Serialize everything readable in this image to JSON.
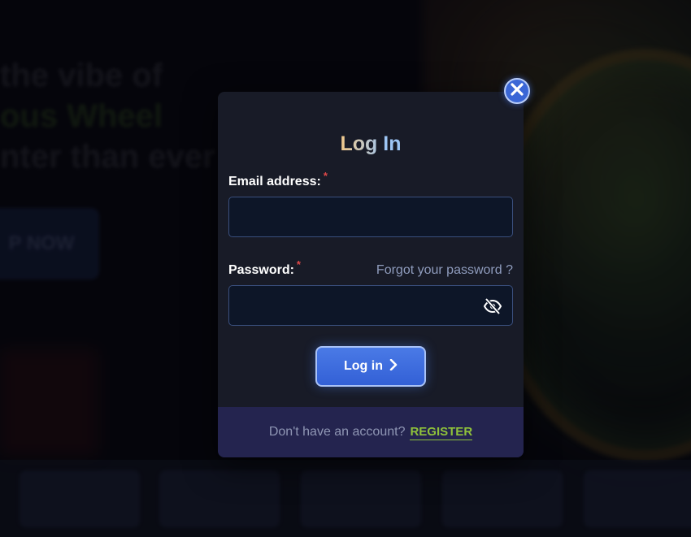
{
  "background": {
    "headline_line1": "the vibe of",
    "headline_line2": "ous Wheel",
    "headline_line3": "nter than ever",
    "cta_label": "P NOW"
  },
  "modal": {
    "title": "Log In",
    "email": {
      "label": "Email address:",
      "required_mark": "*",
      "value": "",
      "placeholder": ""
    },
    "password": {
      "label": "Password:",
      "required_mark": "*",
      "value": "",
      "placeholder": "",
      "toggle_icon": "eye-off-icon"
    },
    "forgot_password": "Forgot your password ?",
    "login_button": "Log in",
    "login_icon": "chevron-right-icon",
    "close_icon": "close-icon",
    "footer": {
      "prompt": "Don't have an account?",
      "register_link": "REGISTER"
    }
  },
  "colors": {
    "accent_blue": "#3a66d6",
    "register_green": "#8fc23a",
    "required_red": "#e04848",
    "modal_bg": "#181b27",
    "footer_bg": "#24244f"
  }
}
